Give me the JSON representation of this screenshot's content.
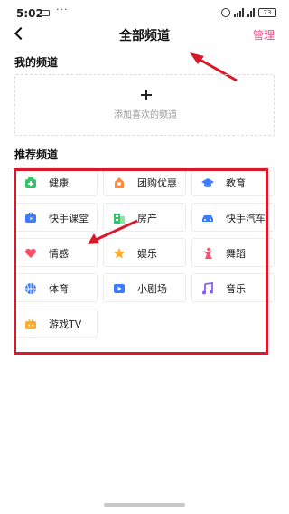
{
  "status_bar": {
    "time": "5:02",
    "dots": "···",
    "battery": "73"
  },
  "header": {
    "title": "全部频道",
    "manage_label": "管理"
  },
  "my_channels": {
    "title": "我的频道",
    "add_hint": "添加喜欢的频道"
  },
  "recommended": {
    "title": "推荐频道",
    "items": [
      {
        "label": "健康",
        "icon": "health-icon",
        "color": "#35c36b"
      },
      {
        "label": "团购优惠",
        "icon": "group-buy-icon",
        "color": "#ff8a3d"
      },
      {
        "label": "教育",
        "icon": "graduation-cap-icon",
        "color": "#3b7bff"
      },
      {
        "label": "快手课堂",
        "icon": "tv-class-icon",
        "color": "#3b7bff"
      },
      {
        "label": "房产",
        "icon": "building-icon",
        "color": "#35c36b"
      },
      {
        "label": "快手汽车",
        "icon": "car-icon",
        "color": "#3b7bff"
      },
      {
        "label": "情感",
        "icon": "heart-icon",
        "color": "#ff4d6a"
      },
      {
        "label": "娱乐",
        "icon": "star-icon",
        "color": "#ffab2e"
      },
      {
        "label": "舞蹈",
        "icon": "dance-icon",
        "color": "#ff4d6a"
      },
      {
        "label": "体育",
        "icon": "basketball-icon",
        "color": "#3b7bff"
      },
      {
        "label": "小剧场",
        "icon": "play-icon",
        "color": "#3b7bff"
      },
      {
        "label": "音乐",
        "icon": "music-note-icon",
        "color": "#8a5cf6"
      },
      {
        "label": "游戏TV",
        "icon": "game-tv-icon",
        "color": "#ffab2e"
      }
    ]
  }
}
